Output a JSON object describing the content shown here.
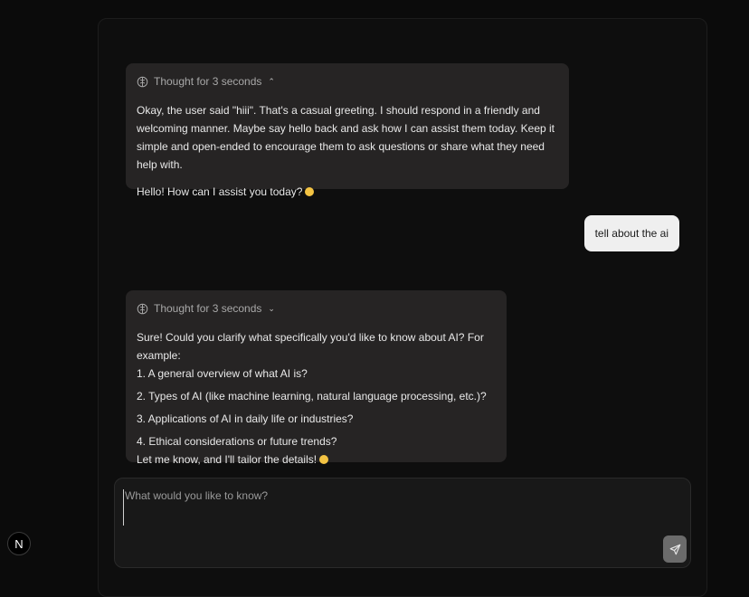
{
  "conversation": {
    "messages": [
      {
        "role": "assistant",
        "thought_label": "Thought for 3 seconds",
        "thought_expanded": true,
        "reasoning": "Okay, the user said \"hiii\". That's a casual greeting. I should respond in a friendly and welcoming manner. Maybe say hello back and ask how I can assist them today. Keep it simple and open-ended to encourage them to ask questions or share what they need help with.",
        "reply": "Hello! How can I assist you today?"
      },
      {
        "role": "user",
        "text": "tell about the ai"
      },
      {
        "role": "assistant",
        "thought_label": "Thought for 3 seconds",
        "thought_expanded": false,
        "reply_lines": [
          "Sure! Could you clarify what specifically you'd like to know about AI? For example:",
          "1. A general overview of what AI is?",
          "2. Types of AI (like machine learning, natural language processing, etc.)?",
          "3. Applications of AI in daily life or industries?",
          "4. Ethical considerations or future trends?",
          "Let me know, and I'll tailor the details!"
        ]
      }
    ]
  },
  "composer": {
    "placeholder": "What would you like to know?",
    "value": ""
  },
  "logo": {
    "letter": "N"
  },
  "icons": {
    "thought": "brain-icon",
    "expanded": "chevron-up-icon",
    "collapsed": "chevron-down-icon",
    "send": "send-icon",
    "emoji": "smiling-face-emoji"
  },
  "colors": {
    "background": "#0b0b0b",
    "assistant_bubble": "#262424",
    "user_bubble": "#efefef",
    "send_button": "#6b6b6b"
  }
}
